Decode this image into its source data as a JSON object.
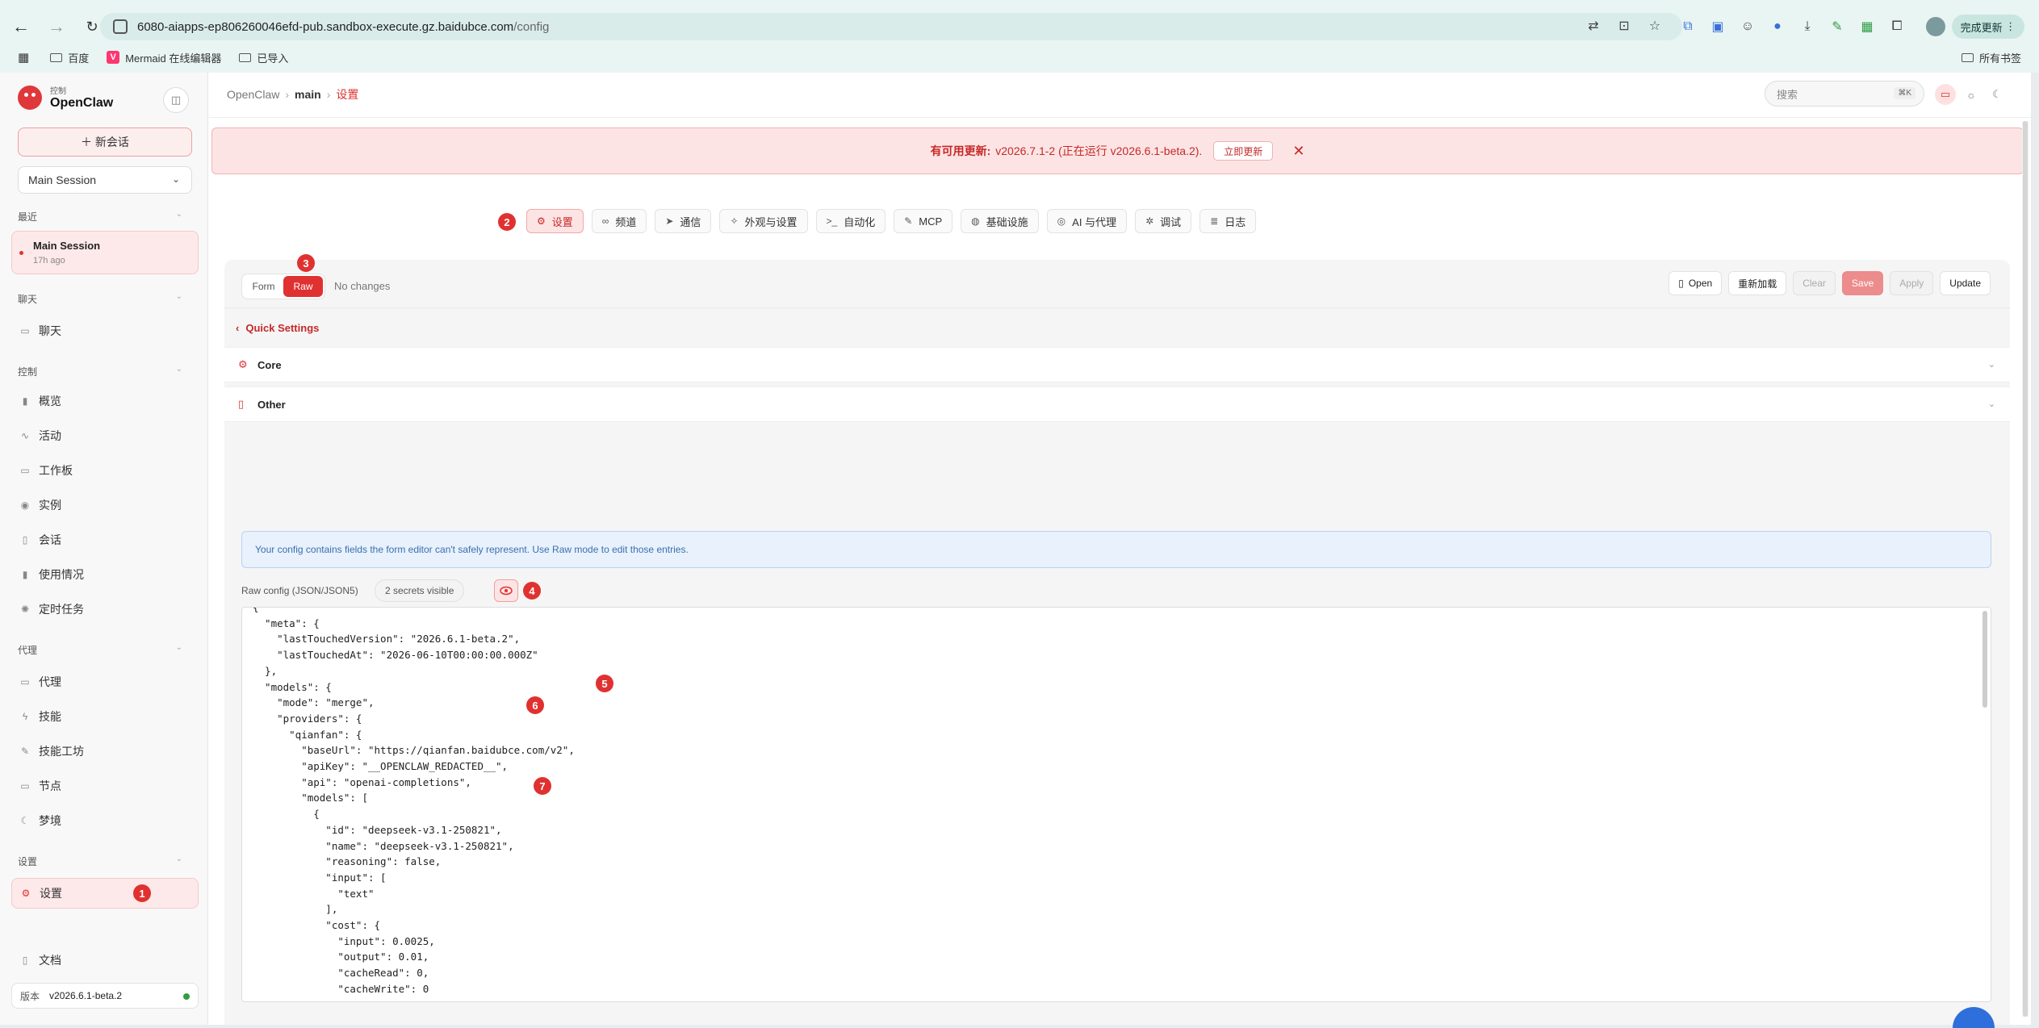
{
  "browser": {
    "url_host": "6080-aiapps-ep806260046efd-pub.sandbox-execute.gz.baidubce.com",
    "url_path": "/config",
    "finish_update": "完成更新",
    "bookmarks": [
      {
        "label": "百度",
        "icon": "folder-icon"
      },
      {
        "label": "Mermaid 在线编辑器",
        "icon": "mermaid-icon"
      },
      {
        "label": "已导入",
        "icon": "folder-icon"
      }
    ],
    "all_bookmarks": "所有书签"
  },
  "sidebar": {
    "brand_sub": "控制",
    "brand_name": "OpenClaw",
    "new_chat": "＋ 新会话",
    "session_select": "Main Session",
    "sections": {
      "recent": "最近",
      "chat": "聊天",
      "control": "控制",
      "agent": "代理",
      "settings": "设置"
    },
    "recent_item": {
      "title": "Main Session",
      "time": "17h ago"
    },
    "items": {
      "chat": "聊天",
      "overview": "概览",
      "activity": "活动",
      "workboard": "工作板",
      "instances": "实例",
      "sessions": "会话",
      "usage": "使用情况",
      "cron": "定时任务",
      "agents": "代理",
      "skills": "技能",
      "skill_workshop": "技能工坊",
      "nodes": "节点",
      "dreams": "梦境",
      "settings": "设置",
      "docs": "文档"
    },
    "version_label": "版本",
    "version": "v2026.6.1-beta.2"
  },
  "topbar": {
    "crumbs": [
      "OpenClaw",
      "main",
      "设置"
    ],
    "search_placeholder": "搜索",
    "search_kbd": "⌘K"
  },
  "banner": {
    "label": "有可用更新:",
    "text": "v2026.7.1-2 (正在运行 v2026.6.1-beta.2).",
    "button": "立即更新",
    "close": "✕"
  },
  "tabs": [
    {
      "label": "设置",
      "icon": "gear-icon"
    },
    {
      "label": "频道",
      "icon": "link-icon"
    },
    {
      "label": "通信",
      "icon": "send-icon"
    },
    {
      "label": "外观与设置",
      "icon": "sparkle-icon"
    },
    {
      "label": "自动化",
      "icon": "terminal-icon"
    },
    {
      "label": "MCP",
      "icon": "wrench-icon"
    },
    {
      "label": "基础设施",
      "icon": "globe-icon"
    },
    {
      "label": "AI 与代理",
      "icon": "ai-icon"
    },
    {
      "label": "调试",
      "icon": "bug-icon"
    },
    {
      "label": "日志",
      "icon": "log-icon"
    }
  ],
  "config": {
    "mode_form": "Form",
    "mode_raw": "Raw",
    "status": "No changes",
    "actions": {
      "open": "Open",
      "reload": "重新加载",
      "clear": "Clear",
      "save": "Save",
      "apply": "Apply",
      "update": "Update"
    },
    "quick_settings": "Quick Settings",
    "sections": [
      "Core",
      "Other"
    ],
    "info": "Your config contains fields the form editor can't safely represent. Use Raw mode to edit those entries.",
    "raw_label": "Raw config (JSON/JSON5)",
    "secrets": "2 secrets visible",
    "raw_text": "{\n  \"meta\": {\n    \"lastTouchedVersion\": \"2026.6.1-beta.2\",\n    \"lastTouchedAt\": \"2026-06-10T00:00:00.000Z\"\n  },\n  \"models\": {\n    \"mode\": \"merge\",\n    \"providers\": {\n      \"qianfan\": {\n        \"baseUrl\": \"https://qianfan.baidubce.com/v2\",\n        \"apiKey\": \"__OPENCLAW_REDACTED__\",\n        \"api\": \"openai-completions\",\n        \"models\": [\n          {\n            \"id\": \"deepseek-v3.1-250821\",\n            \"name\": \"deepseek-v3.1-250821\",\n            \"reasoning\": false,\n            \"input\": [\n              \"text\"\n            ],\n            \"cost\": {\n              \"input\": 0.0025,\n              \"output\": 0.01,\n              \"cacheRead\": 0,\n              \"cacheWrite\": 0"
  },
  "badges": [
    "1",
    "2",
    "3",
    "4",
    "5",
    "6",
    "7"
  ],
  "colors": {
    "accent": "#e03131",
    "banner_bg": "#fde4e4",
    "info_bg": "#e8f1fc"
  }
}
